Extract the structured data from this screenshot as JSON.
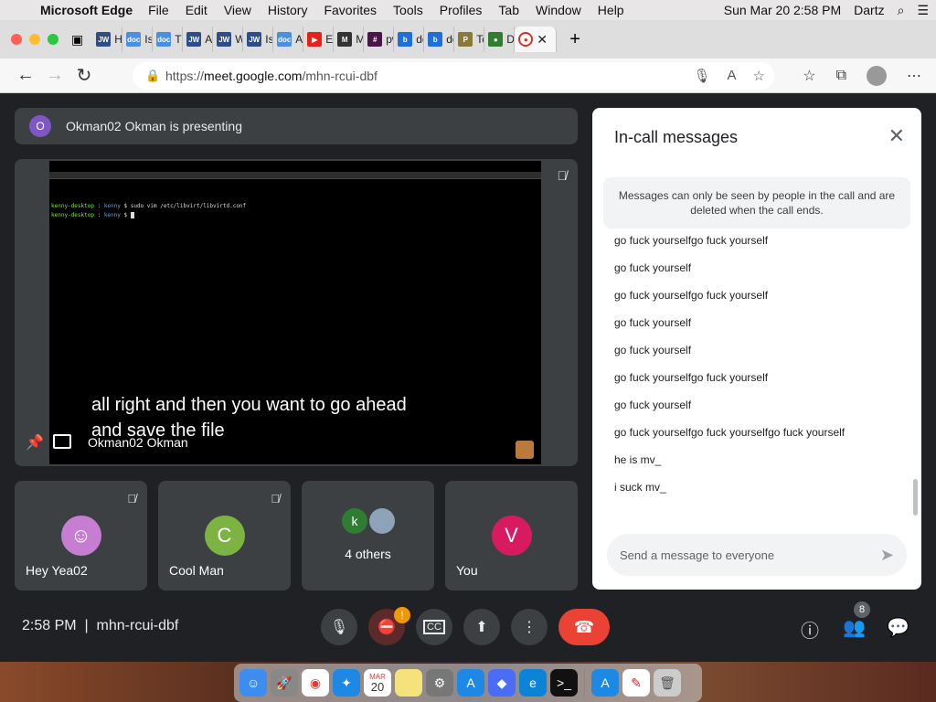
{
  "menubar": {
    "app": "Microsoft Edge",
    "items": [
      "File",
      "Edit",
      "View",
      "History",
      "Favorites",
      "Tools",
      "Profiles",
      "Tab",
      "Window",
      "Help"
    ],
    "datetime": "Sun Mar 20  2:58 PM",
    "user": "Dartz"
  },
  "tabs": [
    {
      "label": "Ho",
      "icon": "JW",
      "color": "#2d4e8a"
    },
    {
      "label": "Is t",
      "icon": "doc",
      "color": "#4a8fe0"
    },
    {
      "label": "The",
      "icon": "doc",
      "color": "#4a8fe0"
    },
    {
      "label": "Am",
      "icon": "JW",
      "color": "#2d4e8a"
    },
    {
      "label": "Wh",
      "icon": "JW",
      "color": "#2d4e8a"
    },
    {
      "label": "Is H",
      "icon": "JW",
      "color": "#2d4e8a"
    },
    {
      "label": "An",
      "icon": "doc",
      "color": "#4a8fe0"
    },
    {
      "label": "Edi",
      "icon": "▶",
      "color": "#e62117"
    },
    {
      "label": "Ma",
      "icon": "M",
      "color": "#333333"
    },
    {
      "label": "pw",
      "icon": "#",
      "color": "#4a154b"
    },
    {
      "label": "dov",
      "icon": "b",
      "color": "#1e6fd9"
    },
    {
      "label": "dov",
      "icon": "b",
      "color": "#1e6fd9"
    },
    {
      "label": "Top",
      "icon": "P",
      "color": "#8a7a3a"
    },
    {
      "label": "Do",
      "icon": "●",
      "color": "#2e7d32"
    }
  ],
  "address": {
    "scheme": "https://",
    "host": "meet.google.com",
    "path": "/mhn-rcui-dbf"
  },
  "meet": {
    "presenting_initial": "O",
    "presenting_text": "Okman02 Okman is presenting",
    "terminal_line1_user": "kenny-desktop",
    "terminal_line1_path": "kenny",
    "terminal_line1_cmd": "$ sudo vim /etc/libvirt/libvirtd.conf",
    "terminal_line2_user": "kenny-desktop",
    "terminal_line2_path": "kenny",
    "terminal_line2_prompt": "$",
    "caption_line1": "all right and then you want to go ahead",
    "caption_line2": "and save the file",
    "presenter_name": "Okman02 Okman",
    "tiles": [
      {
        "name": "Hey Yea02",
        "initial": "",
        "color": "#c77dd1"
      },
      {
        "name": "Cool Man",
        "initial": "C",
        "color": "#7cb342"
      },
      {
        "name": "4 others",
        "initial": "k",
        "color": "#2e7d32"
      },
      {
        "name": "You",
        "initial": "V",
        "color": "#d81b60"
      }
    ],
    "time": "2:58 PM",
    "meeting_code": "mhn-rcui-dbf",
    "participants_count": "8",
    "alert_badge": "!"
  },
  "chat": {
    "title": "In-call messages",
    "notice": "Messages can only be seen by people in the call and are deleted when the call ends.",
    "messages": [
      "go fuck yourselfgo fuck yourself",
      "go fuck yourself",
      "go fuck yourselfgo fuck yourself",
      "go fuck yourself",
      "go fuck yourself",
      "go fuck yourselfgo fuck yourself",
      "go fuck yourself",
      "go fuck yourselfgo fuck yourselfgo fuck yourself",
      "he is mv_",
      "i suck mv_"
    ],
    "placeholder": "Send a message to everyone"
  },
  "dock": {
    "calendar_month": "MAR",
    "calendar_day": "20"
  }
}
